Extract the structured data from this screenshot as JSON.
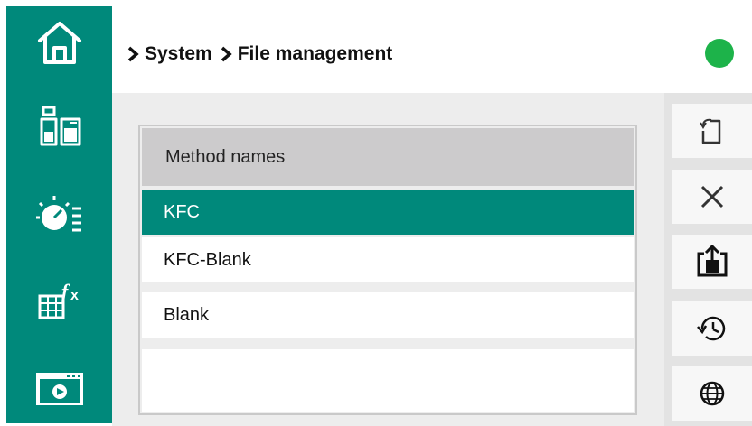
{
  "header": {
    "breadcrumb": [
      "System",
      "File management"
    ],
    "status_color": "#1db34a"
  },
  "sidebar": {
    "items": [
      {
        "icon": "home-icon"
      },
      {
        "icon": "reagent-bottles-icon"
      },
      {
        "icon": "titration-settings-icon"
      },
      {
        "icon": "formula-table-icon"
      },
      {
        "icon": "video-player-icon"
      }
    ],
    "color": "#00897b"
  },
  "list": {
    "header": "Method names",
    "rows": [
      "KFC",
      "KFC-Blank",
      "Blank",
      ""
    ],
    "selected_index": 0
  },
  "toolbar": {
    "buttons": [
      {
        "icon": "file-import-icon"
      },
      {
        "icon": "delete-icon"
      },
      {
        "icon": "export-icon"
      },
      {
        "icon": "history-icon"
      },
      {
        "icon": "globe-icon"
      }
    ]
  }
}
